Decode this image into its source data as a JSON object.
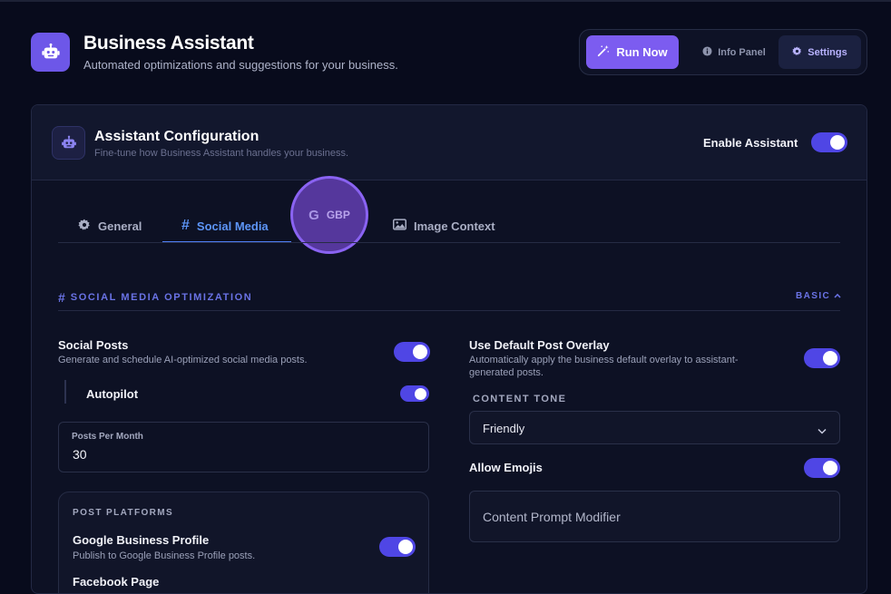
{
  "header": {
    "title": "Business Assistant",
    "subtitle": "Automated optimizations and suggestions for your business.",
    "icon": "robot-icon"
  },
  "actions": {
    "run_now": "Run Now",
    "info_panel": "Info Panel",
    "settings": "Settings"
  },
  "config": {
    "title": "Assistant Configuration",
    "subtitle": "Fine-tune how Business Assistant handles your business.",
    "enable_label": "Enable Assistant",
    "enable_on": true
  },
  "tabs": [
    {
      "label": "General",
      "icon": "gear-icon"
    },
    {
      "label": "Social Media",
      "icon": "hash-icon",
      "active": true
    },
    {
      "label": "GBP",
      "icon": "google-icon"
    },
    {
      "label": "Image Context",
      "icon": "image-icon"
    }
  ],
  "section": {
    "title": "SOCIAL MEDIA OPTIMIZATION",
    "mode": "BASIC"
  },
  "left": {
    "social_posts_label": "Social Posts",
    "social_posts_desc": "Generate and schedule AI-optimized social media posts.",
    "social_posts_on": true,
    "autopilot_label": "Autopilot",
    "autopilot_on": true,
    "posts_per_month_label": "Posts Per Month",
    "posts_per_month_value": "30",
    "platforms_title": "POST PLATFORMS",
    "gbp_label": "Google Business Profile",
    "gbp_desc": "Publish to Google Business Profile posts.",
    "gbp_on": true,
    "next_platform_label": "Facebook Page"
  },
  "right": {
    "overlay_label": "Use Default Post Overlay",
    "overlay_desc": "Automatically apply the business default overlay to assistant-generated posts.",
    "overlay_on": true,
    "tone_label": "CONTENT TONE",
    "tone_value": "Friendly",
    "emojis_label": "Allow Emojis",
    "emojis_on": true,
    "prompt_placeholder": "Content Prompt Modifier"
  },
  "colors": {
    "accent": "#7c5cf0",
    "toggle_on": "#4f46e5",
    "section_accent": "#6a73e6",
    "background": "#080b1c"
  }
}
